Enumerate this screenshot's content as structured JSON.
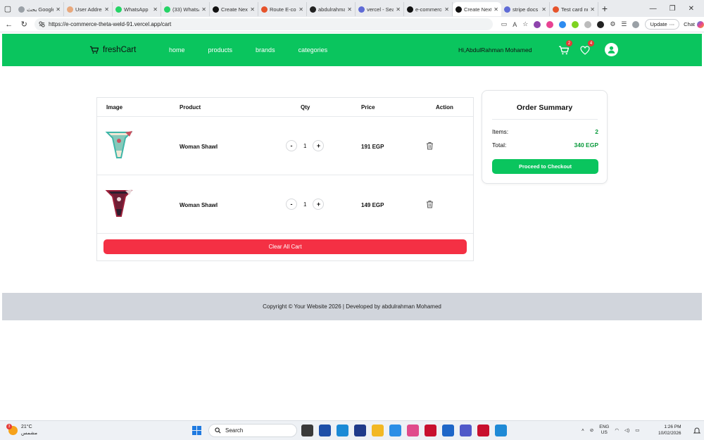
{
  "browser": {
    "tabs": [
      {
        "label": "بحث Google",
        "color": "#9aa0a6"
      },
      {
        "label": "User Addres",
        "color": "#e8a87c"
      },
      {
        "label": "WhatsApp",
        "color": "#25d366"
      },
      {
        "label": "(33) WhatsA",
        "color": "#25d366"
      },
      {
        "label": "Create Next",
        "color": "#111111"
      },
      {
        "label": "Route E-con",
        "color": "#e6532b"
      },
      {
        "label": "abdulrahma",
        "color": "#222222"
      },
      {
        "label": "vercel - Sea",
        "color": "#5f6bd6"
      },
      {
        "label": "e-commerce",
        "color": "#111111"
      },
      {
        "label": "Create Next",
        "color": "#111111",
        "active": true
      },
      {
        "label": "stripe docs",
        "color": "#5f6bd6"
      },
      {
        "label": "Test card nu",
        "color": "#e6532b"
      }
    ],
    "url": "https://e-commerce-theta-weld-91.vercel.app/cart",
    "update_label": "Update",
    "chat_label": "Chat"
  },
  "navbar": {
    "brand": "freshCart",
    "links": [
      "home",
      "products",
      "brands",
      "categories"
    ],
    "greeting": "Hi,AbdulRahman Mohamed",
    "cart_count": "2",
    "wishlist_count": "4"
  },
  "cart": {
    "headers": {
      "image": "Image",
      "product": "Product",
      "qty": "Qty",
      "price": "Price",
      "action": "Action"
    },
    "items": [
      {
        "name": "Woman Shawl",
        "qty": "1",
        "price": "191 EGP",
        "colors": [
          "#3fb6a8",
          "#f1e7d5",
          "#c9505f"
        ]
      },
      {
        "name": "Woman Shawl",
        "qty": "1",
        "price": "149 EGP",
        "colors": [
          "#9c1f3a",
          "#2b1d2e",
          "#e9d7d9"
        ]
      }
    ],
    "minus": "-",
    "plus": "+",
    "clear_label": "Clear All Cart"
  },
  "summary": {
    "title": "Order Summary",
    "items_label": "Items:",
    "items_value": "2",
    "total_label": "Total:",
    "total_value": "340 EGP",
    "checkout_label": "Proceed to Checkout"
  },
  "footer": {
    "text": "Copyright © Your Website 2026 | Developed by abdulrahman Mohamed"
  },
  "taskbar": {
    "weather_temp": "21°C",
    "weather_desc": "مشمس",
    "weather_badge": "3",
    "search_label": "Search",
    "lang": "ENG",
    "region": "US",
    "time": "1:26 PM",
    "date": "10/02/2026",
    "apps": [
      "#3a3a3a",
      "#1e4fa8",
      "#1b8ad6",
      "#1f3a8a",
      "#f2b824",
      "#2b8ee6",
      "#e04b8b",
      "#c8102e",
      "#1e66c8",
      "#5059c9",
      "#c8102e",
      "#1f8ad6"
    ]
  }
}
